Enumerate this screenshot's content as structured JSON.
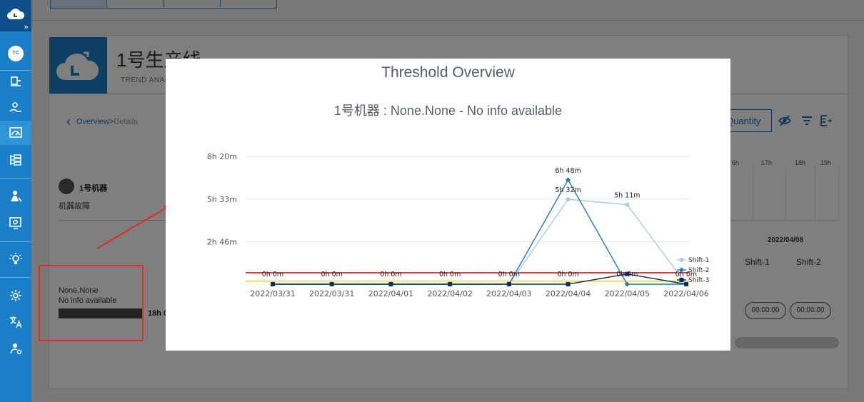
{
  "sidebar": {
    "avatar_initials": "TC",
    "expand_glyph": "»",
    "icons": [
      "cloud-logo-icon",
      "production-icon",
      "machine-hand-icon",
      "dashboard-icon",
      "list-tree-icon",
      "worker-icon",
      "monitor-settings-icon",
      "lightbulb-icon",
      "settings-icon",
      "translate-icon",
      "user-settings-icon"
    ]
  },
  "page": {
    "line_title": "1号生产线",
    "subtitle": "TREND ANAL",
    "breadcrumb_link": "Overview",
    "breadcrumb_sep": ">",
    "breadcrumb_current": "Details",
    "machine_name": "1号机器",
    "machine_status": "机器故障",
    "none_line1": "None.None",
    "none_line2": "No info available",
    "hours_label": "18h 0",
    "quantity_label": "Quantity",
    "hour_headers": [
      "6h",
      "17h",
      "18h",
      "19h"
    ],
    "right_date": "2022/04/08",
    "right_shifts": [
      "Shift-1",
      "Shift-2"
    ],
    "right_times": [
      "00:00:00",
      "00:00:00"
    ]
  },
  "modal": {
    "title": "Threshold Overview",
    "subtitle": "1号机器 : None.None - No info available"
  },
  "colors": {
    "sidebar": "#1a7fc7",
    "shift1": "#a6cde3",
    "shift2": "#1f78b4",
    "shift3": "#0d2c5e",
    "threshold_red": "#e31a1c",
    "threshold_yellow": "#ffd21f"
  },
  "chart_data": {
    "type": "line",
    "x": [
      "2022/03/31",
      "2022/03/31",
      "2022/04/01",
      "2022/04/02",
      "2022/04/03",
      "2022/04/04",
      "2022/04/05",
      "2022/04/06"
    ],
    "y_ticks": [
      "8h 20m",
      "5h 33m",
      "2h 46m"
    ],
    "ylim_minutes": [
      0,
      500
    ],
    "series": [
      {
        "name": "Shift-1",
        "values_minutes": [
          0,
          0,
          0,
          0,
          0,
          332,
          311,
          0
        ]
      },
      {
        "name": "Shift-2",
        "values_minutes": [
          0,
          0,
          0,
          0,
          0,
          408,
          0,
          0
        ]
      },
      {
        "name": "Shift-3",
        "values_minutes": [
          0,
          0,
          0,
          0,
          0,
          0,
          40,
          0
        ]
      }
    ],
    "data_labels": [
      {
        "text": "0h 0m",
        "index": 0
      },
      {
        "text": "0h 0m",
        "index": 1
      },
      {
        "text": "0h 0m",
        "index": 2
      },
      {
        "text": "0h 0m",
        "index": 3
      },
      {
        "text": "0h 0m",
        "index": 4
      },
      {
        "text": "0h 0m",
        "index": 5
      },
      {
        "text": "0h 0m",
        "index": 6
      },
      {
        "text": "0h 0m",
        "index": 7
      },
      {
        "text": "6h 48m",
        "index": 5
      },
      {
        "text": "5h 32m",
        "index": 5
      },
      {
        "text": "5h 11m",
        "index": 6
      }
    ],
    "thresholds_minutes": [
      {
        "color": "red",
        "value": 45
      },
      {
        "color": "yellow",
        "value": 12
      }
    ],
    "legend": [
      "Shift-1",
      "Shift-2",
      "Shift-3"
    ],
    "legend_position": "right",
    "grid": true
  }
}
